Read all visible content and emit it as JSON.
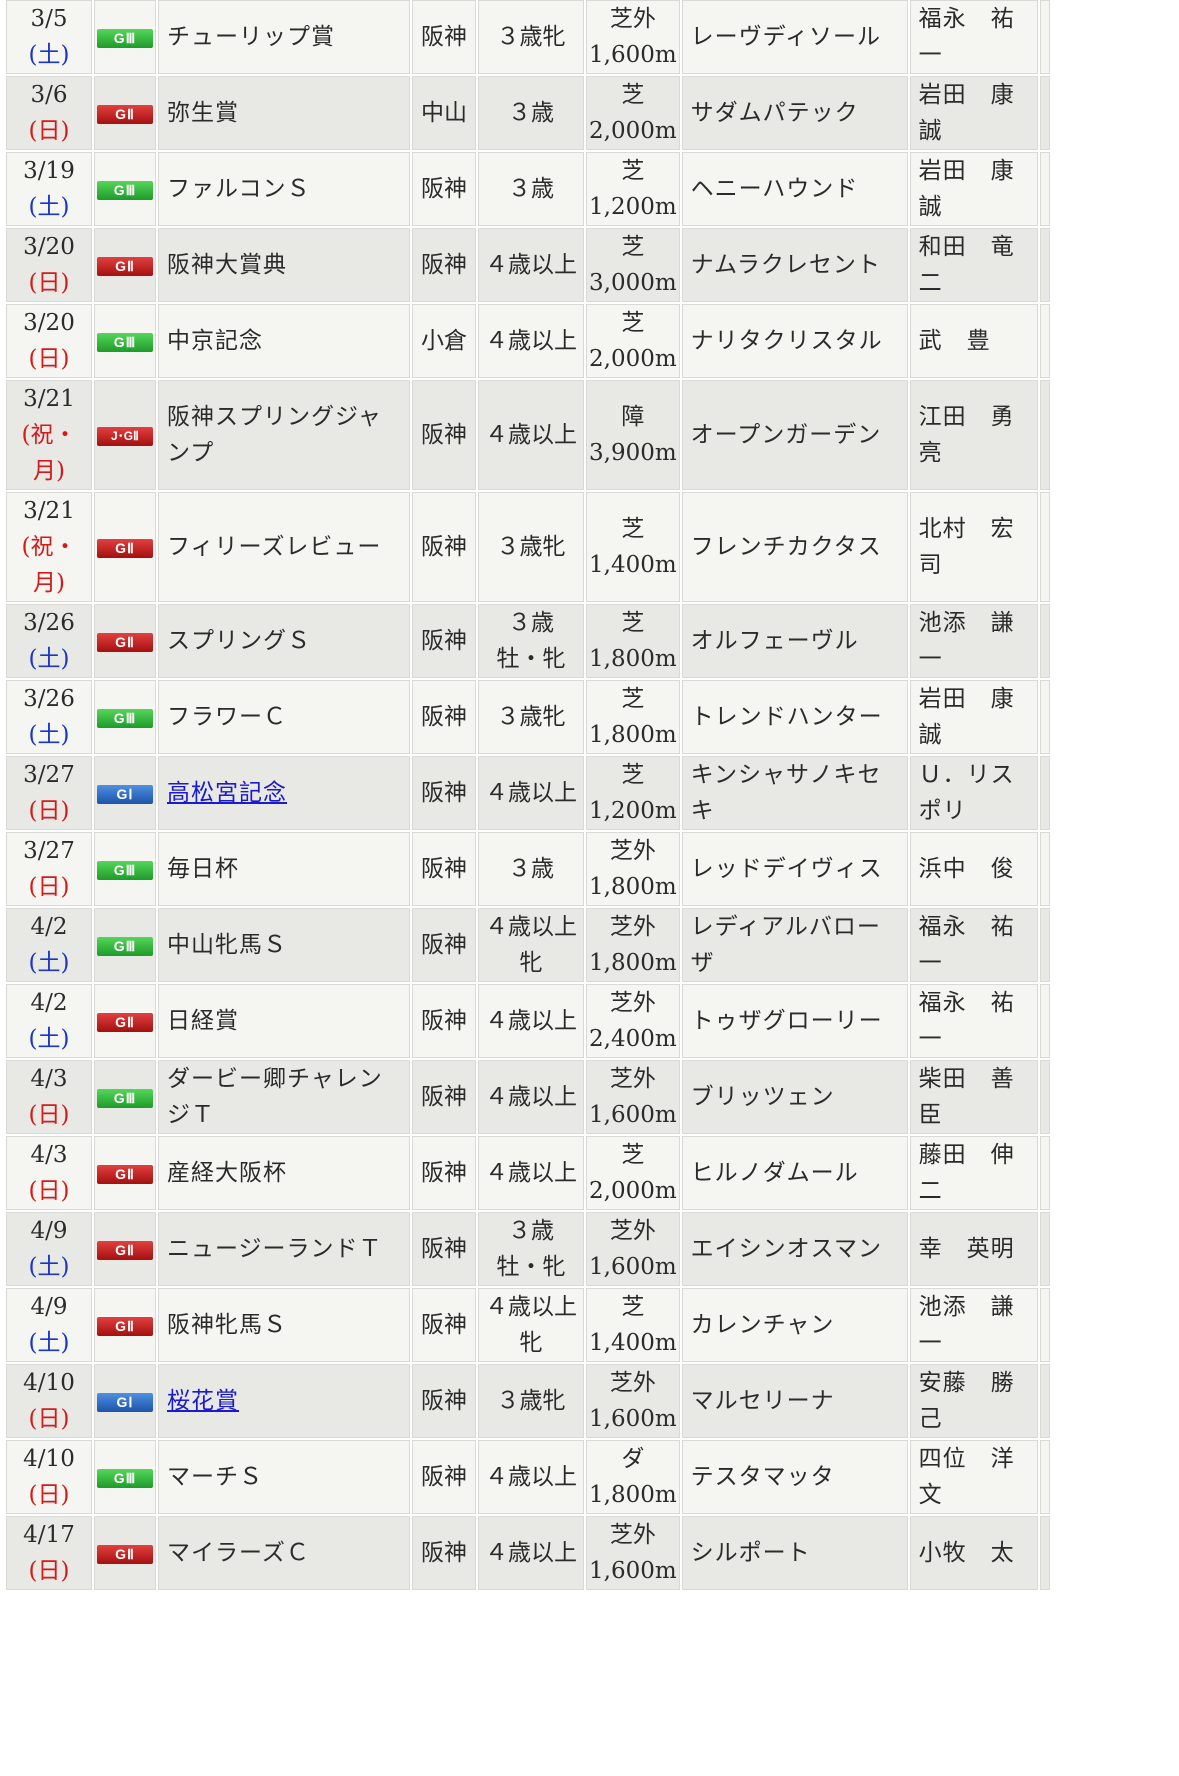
{
  "rows": [
    {
      "date": "3/5",
      "dow": "(土)",
      "dow_type": "sat",
      "grade": "GⅢ",
      "grade_color": "green",
      "name": "チューリップ賞",
      "link": false,
      "venue": "阪神",
      "cond": [
        "３歳牝"
      ],
      "surface": "芝外",
      "distance": "1,600m",
      "horse": "レーヴディソール",
      "jockey": "福永　祐一"
    },
    {
      "date": "3/6",
      "dow": "(日)",
      "dow_type": "sun",
      "grade": "GⅡ",
      "grade_color": "red",
      "name": "弥生賞",
      "link": false,
      "venue": "中山",
      "cond": [
        "３歳"
      ],
      "surface": "芝",
      "distance": "2,000m",
      "horse": "サダムパテック",
      "jockey": "岩田　康誠"
    },
    {
      "date": "3/19",
      "dow": "(土)",
      "dow_type": "sat",
      "grade": "GⅢ",
      "grade_color": "green",
      "name": "ファルコンＳ",
      "link": false,
      "venue": "阪神",
      "cond": [
        "３歳"
      ],
      "surface": "芝",
      "distance": "1,200m",
      "horse": "ヘニーハウンド",
      "jockey": "岩田　康誠"
    },
    {
      "date": "3/20",
      "dow": "(日)",
      "dow_type": "sun",
      "grade": "GⅡ",
      "grade_color": "red",
      "name": "阪神大賞典",
      "link": false,
      "venue": "阪神",
      "cond": [
        "４歳以上"
      ],
      "surface": "芝",
      "distance": "3,000m",
      "horse": "ナムラクレセント",
      "jockey": "和田　竜二"
    },
    {
      "date": "3/20",
      "dow": "(日)",
      "dow_type": "sun",
      "grade": "GⅢ",
      "grade_color": "green",
      "name": "中京記念",
      "link": false,
      "venue": "小倉",
      "cond": [
        "４歳以上"
      ],
      "surface": "芝",
      "distance": "2,000m",
      "horse": "ナリタクリスタル",
      "jockey": "武　豊"
    },
    {
      "date": "3/21",
      "dow": "(祝・月)",
      "dow_type": "sun",
      "grade": "J･GⅡ",
      "grade_color": "jred",
      "name": "阪神スプリングジャンプ",
      "link": false,
      "venue": "阪神",
      "cond": [
        "４歳以上"
      ],
      "surface": "障",
      "distance": "3,900m",
      "horse": "オープンガーデン",
      "jockey": "江田　勇亮"
    },
    {
      "date": "3/21",
      "dow": "(祝・月)",
      "dow_type": "sun",
      "grade": "GⅡ",
      "grade_color": "red",
      "name": "フィリーズレビュー",
      "link": false,
      "venue": "阪神",
      "cond": [
        "３歳牝"
      ],
      "surface": "芝",
      "distance": "1,400m",
      "horse": "フレンチカクタス",
      "jockey": "北村　宏司"
    },
    {
      "date": "3/26",
      "dow": "(土)",
      "dow_type": "sat",
      "grade": "GⅡ",
      "grade_color": "red",
      "name": "スプリングＳ",
      "link": false,
      "venue": "阪神",
      "cond": [
        "３歳",
        "牡・牝"
      ],
      "surface": "芝",
      "distance": "1,800m",
      "horse": "オルフェーヴル",
      "jockey": "池添　謙一"
    },
    {
      "date": "3/26",
      "dow": "(土)",
      "dow_type": "sat",
      "grade": "GⅢ",
      "grade_color": "green",
      "name": "フラワーＣ",
      "link": false,
      "venue": "阪神",
      "cond": [
        "３歳牝"
      ],
      "surface": "芝",
      "distance": "1,800m",
      "horse": "トレンドハンター",
      "jockey": "岩田　康誠"
    },
    {
      "date": "3/27",
      "dow": "(日)",
      "dow_type": "sun",
      "grade": "GⅠ",
      "grade_color": "blue",
      "name": "高松宮記念",
      "link": true,
      "venue": "阪神",
      "cond": [
        "４歳以上"
      ],
      "surface": "芝",
      "distance": "1,200m",
      "horse": "キンシャサノキセキ",
      "jockey": "Ｕ．リスポリ"
    },
    {
      "date": "3/27",
      "dow": "(日)",
      "dow_type": "sun",
      "grade": "GⅢ",
      "grade_color": "green",
      "name": "毎日杯",
      "link": false,
      "venue": "阪神",
      "cond": [
        "３歳"
      ],
      "surface": "芝外",
      "distance": "1,800m",
      "horse": "レッドデイヴィス",
      "jockey": "浜中　俊"
    },
    {
      "date": "4/2",
      "dow": "(土)",
      "dow_type": "sat",
      "grade": "GⅢ",
      "grade_color": "green",
      "name": "中山牝馬Ｓ",
      "link": false,
      "venue": "阪神",
      "cond": [
        "４歳以上",
        "牝"
      ],
      "surface": "芝外",
      "distance": "1,800m",
      "horse": "レディアルバローザ",
      "jockey": "福永　祐一"
    },
    {
      "date": "4/2",
      "dow": "(土)",
      "dow_type": "sat",
      "grade": "GⅡ",
      "grade_color": "red",
      "name": "日経賞",
      "link": false,
      "venue": "阪神",
      "cond": [
        "４歳以上"
      ],
      "surface": "芝外",
      "distance": "2,400m",
      "horse": "トゥザグローリー",
      "jockey": "福永　祐一"
    },
    {
      "date": "4/3",
      "dow": "(日)",
      "dow_type": "sun",
      "grade": "GⅢ",
      "grade_color": "green",
      "name": "ダービー卿チャレンジＴ",
      "link": false,
      "venue": "阪神",
      "cond": [
        "４歳以上"
      ],
      "surface": "芝外",
      "distance": "1,600m",
      "horse": "ブリッツェン",
      "jockey": "柴田　善臣"
    },
    {
      "date": "4/3",
      "dow": "(日)",
      "dow_type": "sun",
      "grade": "GⅡ",
      "grade_color": "red",
      "name": "産経大阪杯",
      "link": false,
      "venue": "阪神",
      "cond": [
        "４歳以上"
      ],
      "surface": "芝",
      "distance": "2,000m",
      "horse": "ヒルノダムール",
      "jockey": "藤田　伸二"
    },
    {
      "date": "4/9",
      "dow": "(土)",
      "dow_type": "sat",
      "grade": "GⅡ",
      "grade_color": "red",
      "name": "ニュージーランドＴ",
      "link": false,
      "venue": "阪神",
      "cond": [
        "３歳",
        "牡・牝"
      ],
      "surface": "芝外",
      "distance": "1,600m",
      "horse": "エイシンオスマン",
      "jockey": "幸　英明"
    },
    {
      "date": "4/9",
      "dow": "(土)",
      "dow_type": "sat",
      "grade": "GⅡ",
      "grade_color": "red",
      "name": "阪神牝馬Ｓ",
      "link": false,
      "venue": "阪神",
      "cond": [
        "４歳以上",
        "牝"
      ],
      "surface": "芝",
      "distance": "1,400m",
      "horse": "カレンチャン",
      "jockey": "池添　謙一"
    },
    {
      "date": "4/10",
      "dow": "(日)",
      "dow_type": "sun",
      "grade": "GⅠ",
      "grade_color": "blue",
      "name": "桜花賞",
      "link": true,
      "venue": "阪神",
      "cond": [
        "３歳牝"
      ],
      "surface": "芝外",
      "distance": "1,600m",
      "horse": "マルセリーナ",
      "jockey": "安藤　勝己"
    },
    {
      "date": "4/10",
      "dow": "(日)",
      "dow_type": "sun",
      "grade": "GⅢ",
      "grade_color": "green",
      "name": "マーチＳ",
      "link": false,
      "venue": "阪神",
      "cond": [
        "４歳以上"
      ],
      "surface": "ダ",
      "distance": "1,800m",
      "horse": "テスタマッタ",
      "jockey": "四位　洋文"
    },
    {
      "date": "4/17",
      "dow": "(日)",
      "dow_type": "sun",
      "grade": "GⅡ",
      "grade_color": "red",
      "name": "マイラーズＣ",
      "link": false,
      "venue": "阪神",
      "cond": [
        "４歳以上"
      ],
      "surface": "芝外",
      "distance": "1,600m",
      "horse": "シルポート",
      "jockey": "小牧　太"
    }
  ]
}
